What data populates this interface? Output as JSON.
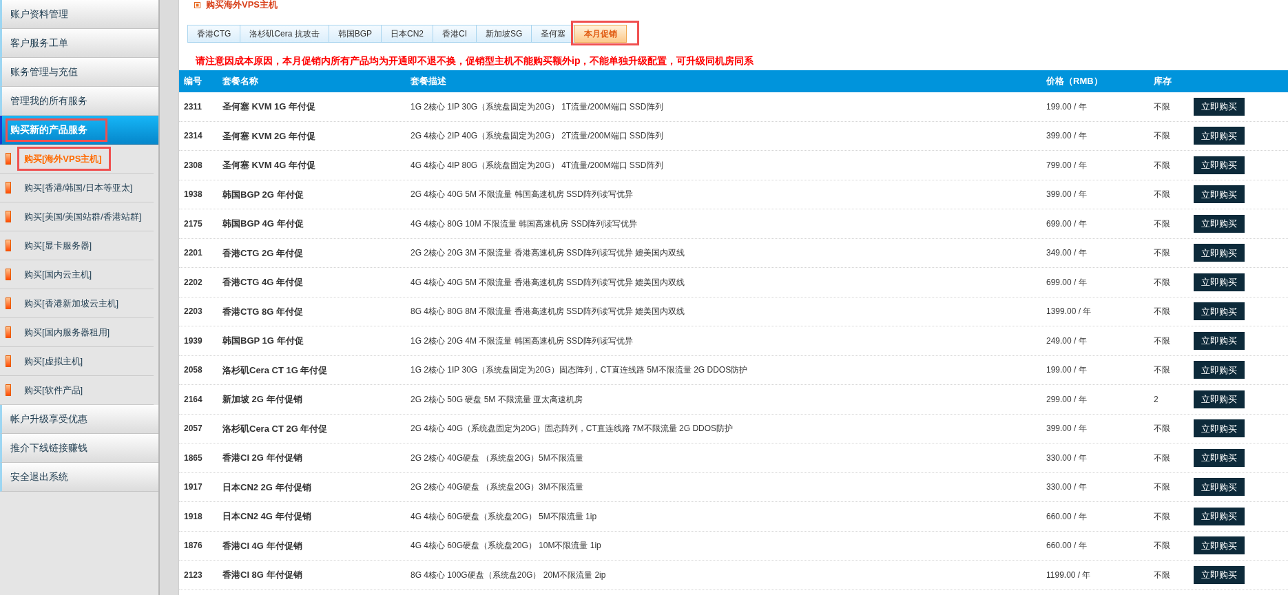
{
  "sidebar": {
    "items": [
      {
        "label": "账户资料管理",
        "selected": false,
        "highlighted": false
      },
      {
        "label": "客户服务工单",
        "selected": false,
        "highlighted": false
      },
      {
        "label": "账务管理与充值",
        "selected": false,
        "highlighted": false
      },
      {
        "label": "管理我的所有服务",
        "selected": false,
        "highlighted": false
      },
      {
        "label": "购买新的产品服务",
        "selected": true,
        "highlighted": true,
        "children": [
          {
            "label": "购买[海外VPS主机]",
            "selected": true,
            "highlighted": true
          },
          {
            "label": "购买[香港/韩国/日本等亚太]",
            "selected": false,
            "highlighted": false
          },
          {
            "label": "购买[美国/美国站群/香港站群]",
            "selected": false,
            "highlighted": false
          },
          {
            "label": "购买[显卡服务器]",
            "selected": false,
            "highlighted": false
          },
          {
            "label": "购买[国内云主机]",
            "selected": false,
            "highlighted": false
          },
          {
            "label": "购买[香港新加坡云主机]",
            "selected": false,
            "highlighted": false
          },
          {
            "label": "购买[国内服务器租用]",
            "selected": false,
            "highlighted": false
          },
          {
            "label": "购买[虚拟主机]",
            "selected": false,
            "highlighted": false
          },
          {
            "label": "购买[软件产品]",
            "selected": false,
            "highlighted": false
          }
        ]
      },
      {
        "label": "帐户升级享受优惠",
        "selected": false,
        "highlighted": false
      },
      {
        "label": "推介下线链接赚钱",
        "selected": false,
        "highlighted": false
      },
      {
        "label": "安全退出系统",
        "selected": false,
        "highlighted": false
      }
    ]
  },
  "page": {
    "title": "购买海外VPS主机"
  },
  "tabs": [
    {
      "label": "香港CTG",
      "selected": false,
      "highlighted": false
    },
    {
      "label": "洛杉矶Cera 抗攻击",
      "selected": false,
      "highlighted": false
    },
    {
      "label": "韩国BGP",
      "selected": false,
      "highlighted": false
    },
    {
      "label": "日本CN2",
      "selected": false,
      "highlighted": false
    },
    {
      "label": "香港CI",
      "selected": false,
      "highlighted": false
    },
    {
      "label": "新加坡SG",
      "selected": false,
      "highlighted": false
    },
    {
      "label": "圣何塞",
      "selected": false,
      "highlighted": false
    },
    {
      "label": "本月促销",
      "selected": true,
      "highlighted": true
    }
  ],
  "notice": "请注意因成本原因，本月促销内所有产品均为开通即不退不换，促销型主机不能购买额外ip，不能单独升级配置，可升级同机房同系",
  "table": {
    "columns": [
      "编号",
      "套餐名称",
      "套餐描述",
      "价格（RMB）",
      "库存"
    ],
    "rows": [
      {
        "id": "2311",
        "name": "圣何塞 KVM 1G 年付促",
        "description": "1G 2核心 1IP 30G（系统盘固定为20G） 1T流量/200M端口 SSD阵列",
        "price": "199.00 / 年",
        "stock": "不限",
        "action": "立即购买"
      },
      {
        "id": "2314",
        "name": "圣何塞 KVM 2G 年付促",
        "description": "2G 4核心 2IP 40G（系统盘固定为20G） 2T流量/200M端口 SSD阵列",
        "price": "399.00 / 年",
        "stock": "不限",
        "action": "立即购买"
      },
      {
        "id": "2308",
        "name": "圣何塞 KVM 4G 年付促",
        "description": "4G 4核心 4IP 80G（系统盘固定为20G） 4T流量/200M端口 SSD阵列",
        "price": "799.00 / 年",
        "stock": "不限",
        "action": "立即购买"
      },
      {
        "id": "1938",
        "name": "韩国BGP 2G 年付促",
        "description": "2G 4核心 40G 5M 不限流量 韩国高速机房 SSD阵列读写优异",
        "price": "399.00 / 年",
        "stock": "不限",
        "action": "立即购买"
      },
      {
        "id": "2175",
        "name": "韩国BGP 4G 年付促",
        "description": "4G 4核心 80G 10M 不限流量 韩国高速机房 SSD阵列读写优异",
        "price": "699.00 / 年",
        "stock": "不限",
        "action": "立即购买"
      },
      {
        "id": "2201",
        "name": "香港CTG 2G 年付促",
        "description": "2G 2核心 20G 3M 不限流量 香港高速机房 SSD阵列读写优异 媲美国内双线",
        "price": "349.00 / 年",
        "stock": "不限",
        "action": "立即购买"
      },
      {
        "id": "2202",
        "name": "香港CTG 4G 年付促",
        "description": "4G 4核心 40G 5M 不限流量 香港高速机房 SSD阵列读写优异 媲美国内双线",
        "price": "699.00 / 年",
        "stock": "不限",
        "action": "立即购买"
      },
      {
        "id": "2203",
        "name": "香港CTG 8G 年付促",
        "description": "8G 4核心 80G 8M 不限流量 香港高速机房 SSD阵列读写优异 媲美国内双线",
        "price": "1399.00 / 年",
        "stock": "不限",
        "action": "立即购买"
      },
      {
        "id": "1939",
        "name": "韩国BGP 1G 年付促",
        "description": "1G 2核心 20G 4M 不限流量 韩国高速机房 SSD阵列读写优异",
        "price": "249.00 / 年",
        "stock": "不限",
        "action": "立即购买"
      },
      {
        "id": "2058",
        "name": "洛杉矶Cera CT 1G 年付促",
        "description": "1G 2核心 1IP 30G（系统盘固定为20G）固态阵列，CT直连线路 5M不限流量 2G DDOS防护",
        "price": "199.00 / 年",
        "stock": "不限",
        "action": "立即购买"
      },
      {
        "id": "2164",
        "name": "新加坡 2G 年付促销",
        "description": "2G 2核心 50G 硬盘 5M 不限流量 亚太高速机房",
        "price": "299.00 / 年",
        "stock": "2",
        "action": "立即购买"
      },
      {
        "id": "2057",
        "name": "洛杉矶Cera CT 2G 年付促",
        "description": "2G 4核心 40G（系统盘固定为20G）固态阵列，CT直连线路 7M不限流量 2G DDOS防护",
        "price": "399.00 / 年",
        "stock": "不限",
        "action": "立即购买"
      },
      {
        "id": "1865",
        "name": "香港CI 2G 年付促销",
        "description": "2G 2核心 40G硬盘 （系统盘20G）5M不限流量",
        "price": "330.00 / 年",
        "stock": "不限",
        "action": "立即购买"
      },
      {
        "id": "1917",
        "name": "日本CN2 2G 年付促销",
        "description": "2G 2核心 40G硬盘 （系统盘20G）3M不限流量",
        "price": "330.00 / 年",
        "stock": "不限",
        "action": "立即购买"
      },
      {
        "id": "1918",
        "name": "日本CN2 4G 年付促销",
        "description": "4G 4核心 60G硬盘（系统盘20G） 5M不限流量 1ip",
        "price": "660.00 / 年",
        "stock": "不限",
        "action": "立即购买"
      },
      {
        "id": "1876",
        "name": "香港CI 4G 年付促销",
        "description": "4G 4核心 60G硬盘（系统盘20G） 10M不限流量 1ip",
        "price": "660.00 / 年",
        "stock": "不限",
        "action": "立即购买"
      },
      {
        "id": "2123",
        "name": "香港CI 8G 年付促销",
        "description": "8G 4核心 100G硬盘（系统盘20G） 20M不限流量 2ip",
        "price": "1199.00 / 年",
        "stock": "不限",
        "action": "立即购买"
      }
    ]
  }
}
